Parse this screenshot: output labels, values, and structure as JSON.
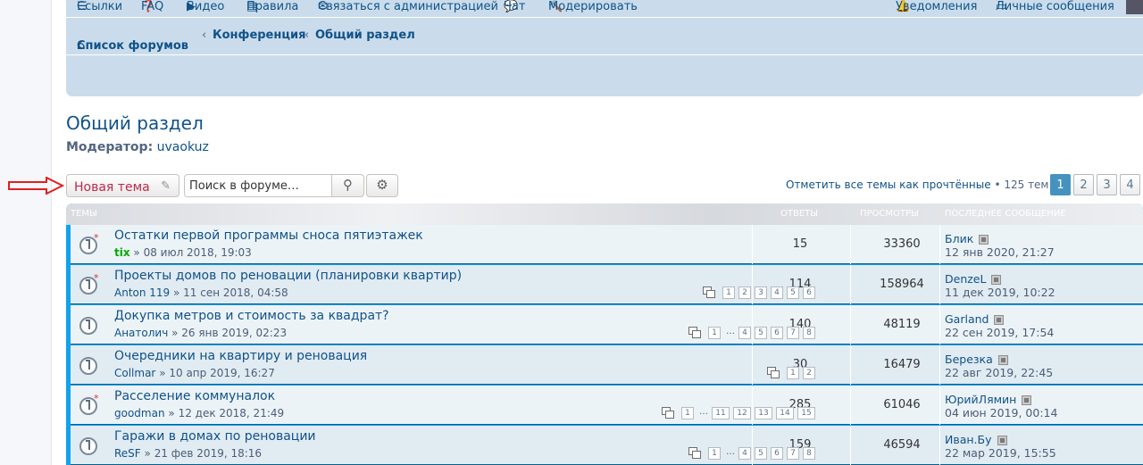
{
  "nav": {
    "links": [
      "Ссылки",
      "FAQ",
      "Видео",
      "Правила",
      "Связаться с администрацией",
      "Чат",
      "Модерировать"
    ],
    "notifications": "Уведомления",
    "messages": "Личные сообщения"
  },
  "breadcrumbs": [
    "Список форумов",
    "Конференция",
    "Общий раздел"
  ],
  "page_title": "Общий раздел",
  "moderator_label": "Модератор:",
  "moderator_name": "uvaokuz",
  "actions": {
    "new_topic": "Новая тема",
    "search_placeholder": "Поиск в форуме…",
    "mark_read": "Отметить все темы как прочтённые",
    "topic_count": "125 тем",
    "pages": [
      "1",
      "2",
      "3",
      "4"
    ]
  },
  "table_headers": {
    "topics": "Темы",
    "replies": "Ответы",
    "views": "Просмотры",
    "last_post": "Последнее сообщение"
  },
  "topics": [
    {
      "title": "Остатки первой программы сноса пятиэтажек",
      "author": "tix",
      "date": "08 июл 2018, 19:03",
      "pages": [],
      "replies": "15",
      "views": "33360",
      "last_author": "Блик",
      "last_date": "12 янв 2020, 21:27"
    },
    {
      "title": "Проекты домов по реновации (планировки квартир)",
      "author": "Anton 119",
      "date": "11 сен 2018, 04:58",
      "pages": [
        "1",
        "2",
        "3",
        "4",
        "5",
        "6"
      ],
      "replies": "114",
      "views": "158964",
      "last_author": "DenzeL",
      "last_date": "11 дек 2019, 10:22"
    },
    {
      "title": "Докупка метров и стоимость за квадрат?",
      "author": "Анатолич",
      "date": "26 янв 2019, 02:23",
      "pages": [
        "1",
        "…",
        "4",
        "5",
        "6",
        "7",
        "8"
      ],
      "replies": "140",
      "views": "48119",
      "last_author": "Garland",
      "last_date": "22 сен 2019, 17:54"
    },
    {
      "title": "Очередники на квартиру и реновация",
      "author": "Collmar",
      "date": "10 апр 2019, 16:27",
      "pages": [
        "1",
        "2"
      ],
      "replies": "30",
      "views": "16479",
      "last_author": "Березка",
      "last_date": "22 авг 2019, 22:45"
    },
    {
      "title": "Расселение коммуналок",
      "author": "goodman",
      "date": "12 дек 2018, 21:49",
      "pages": [
        "1",
        "…",
        "11",
        "12",
        "13",
        "14",
        "15"
      ],
      "replies": "285",
      "views": "61046",
      "last_author": "ЮрийЛямин",
      "last_date": "04 июн 2019, 00:14"
    },
    {
      "title": "Гаражи в домах по реновации",
      "author": "ReSF",
      "date": "21 фев 2019, 18:16",
      "pages": [
        "1",
        "…",
        "4",
        "5",
        "6",
        "7",
        "8"
      ],
      "replies": "159",
      "views": "46594",
      "last_author": "Иван.Бу",
      "last_date": "22 мар 2019, 15:55"
    }
  ]
}
